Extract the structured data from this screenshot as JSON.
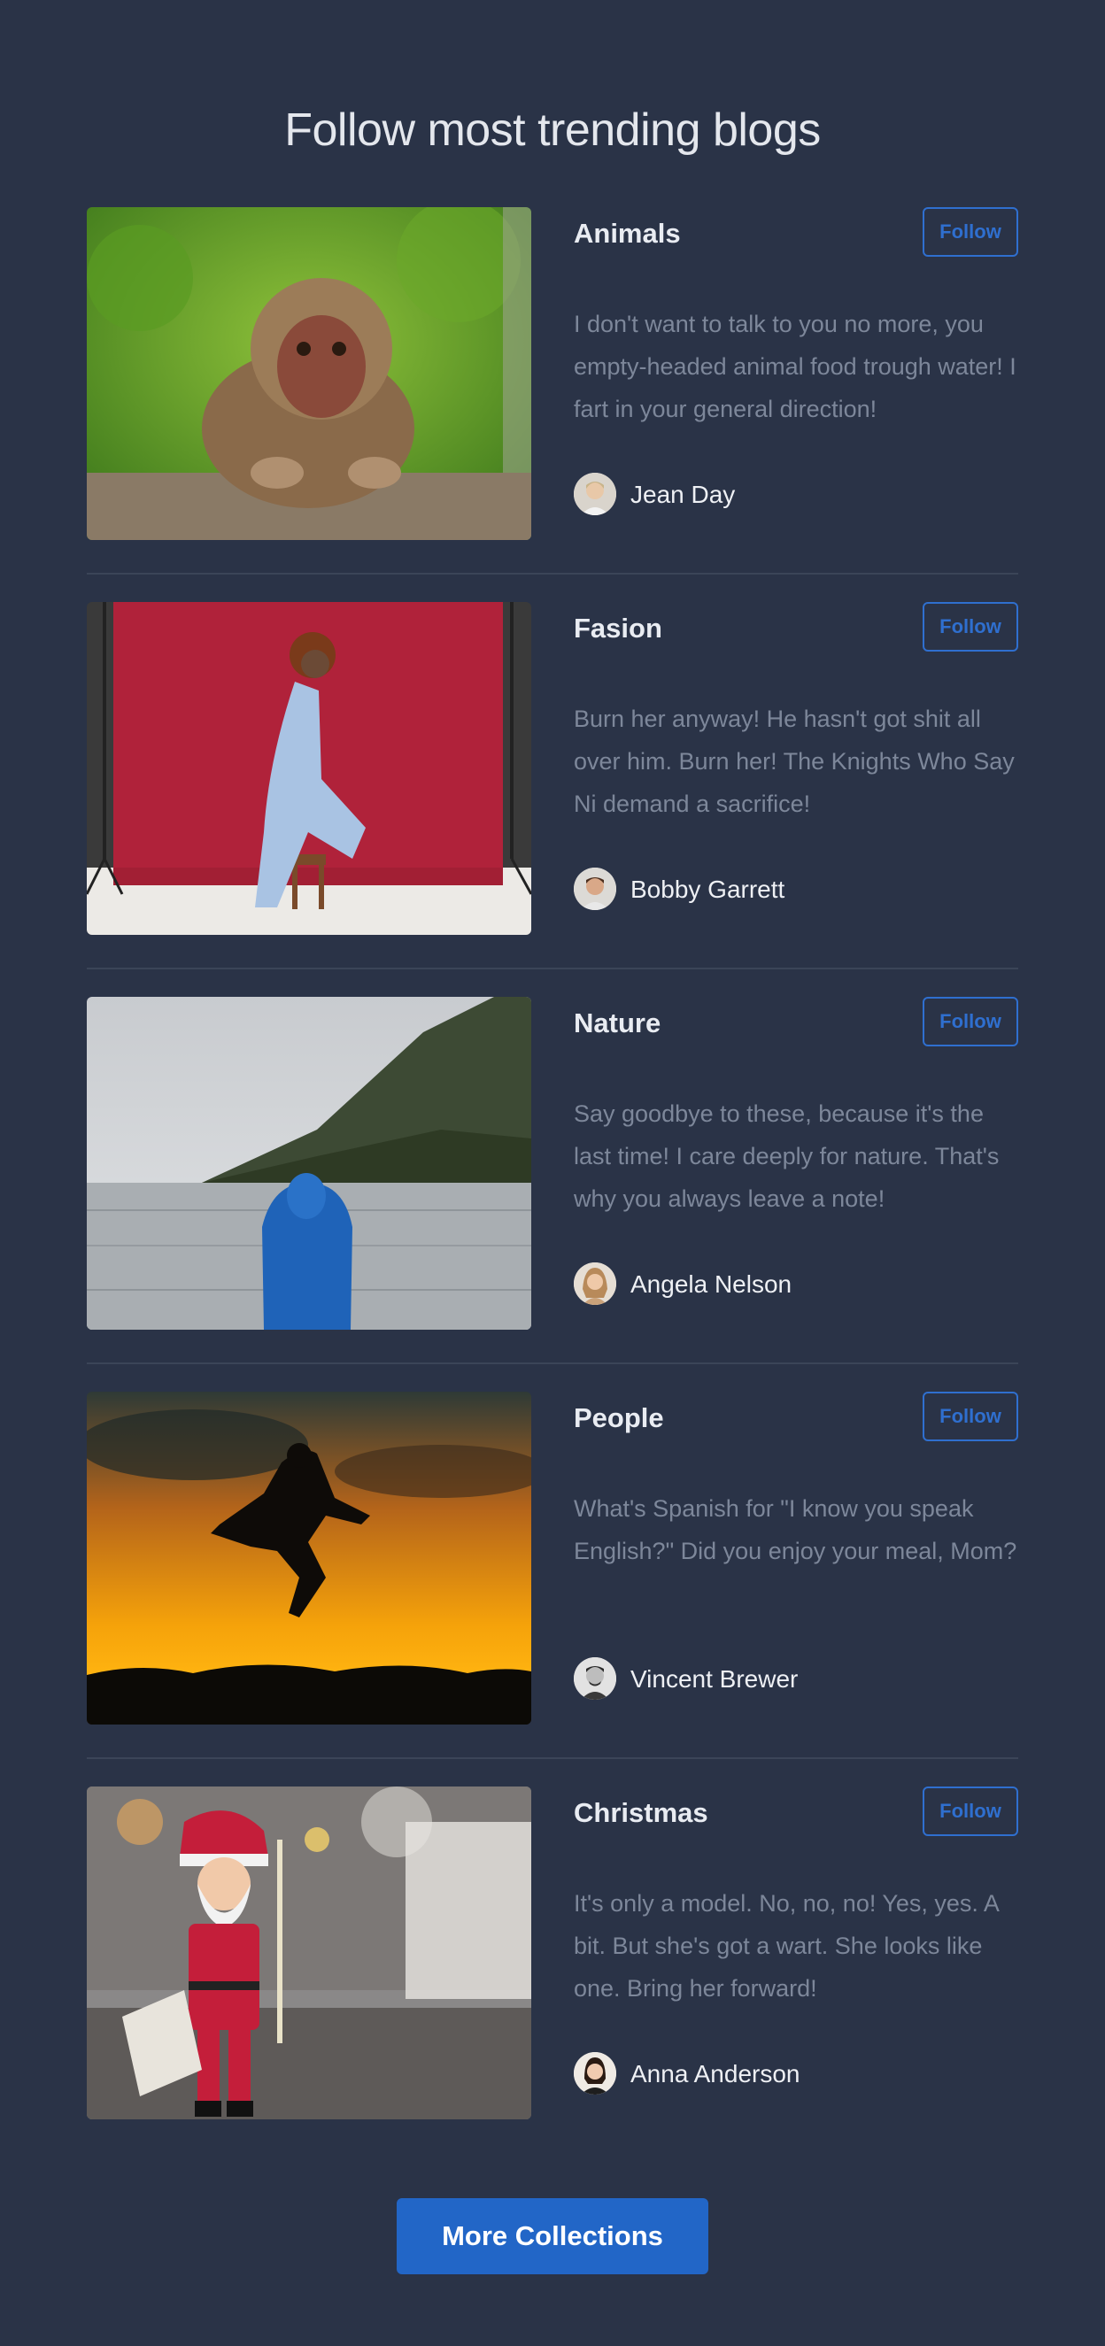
{
  "page": {
    "title": "Follow most trending blogs",
    "more_button": "More Collections",
    "colors": {
      "background": "#2a3347",
      "accent": "#2f6fcf",
      "button": "#2266c7"
    }
  },
  "blogs": [
    {
      "category": "Animals",
      "follow_label": "Follow",
      "description": "I don't want to talk to you no more, you empty-headed animal food trough water! I fart in your general direction!",
      "author": "Jean Day"
    },
    {
      "category": "Fasion",
      "follow_label": "Follow",
      "description": "Burn her anyway! He hasn't got shit all over him. Burn her! The Knights Who Say Ni demand a sacrifice!",
      "author": "Bobby Garrett"
    },
    {
      "category": "Nature",
      "follow_label": "Follow",
      "description": "Say goodbye to these, because it's the last time! I care deeply for nature. That's why you always leave a note!",
      "author": "Angela Nelson"
    },
    {
      "category": "People",
      "follow_label": "Follow",
      "description": "What's Spanish for \"I know you speak English?\" Did you enjoy your meal, Mom?",
      "author": "Vincent Brewer"
    },
    {
      "category": "Christmas",
      "follow_label": "Follow",
      "description": "It's only a model. No, no, no! Yes, yes. A bit. But she's got a wart. She looks like one. Bring her forward!",
      "author": "Anna Anderson"
    }
  ]
}
